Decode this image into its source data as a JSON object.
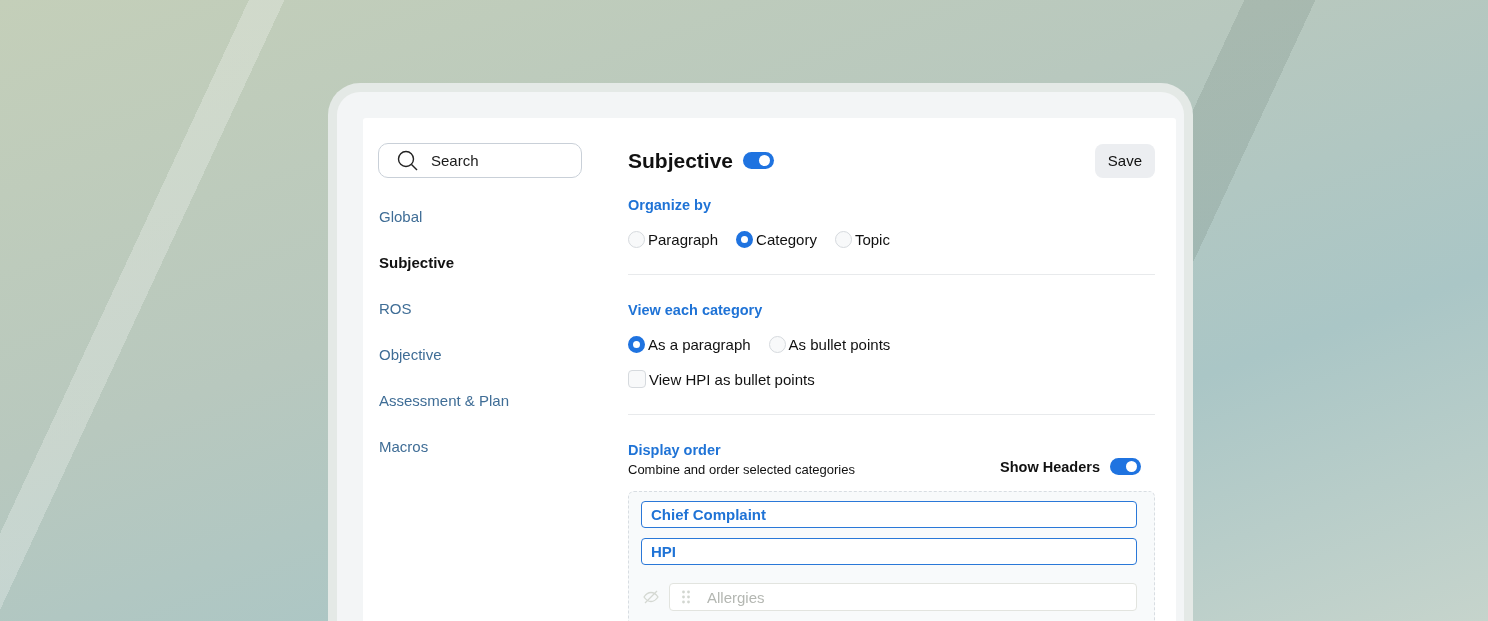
{
  "sidebar": {
    "search": {
      "placeholder": "Search"
    },
    "items": [
      {
        "label": "Global",
        "selected": false
      },
      {
        "label": "Subjective",
        "selected": true
      },
      {
        "label": "ROS",
        "selected": false
      },
      {
        "label": "Objective",
        "selected": false
      },
      {
        "label": "Assessment & Plan",
        "selected": false
      },
      {
        "label": "Macros",
        "selected": false
      }
    ]
  },
  "header": {
    "title": "Subjective",
    "on": true,
    "save": "Save"
  },
  "sections": [
    {
      "heading": "Organize by",
      "options": [
        {
          "label": "Paragraph",
          "selected": false
        },
        {
          "label": "Category",
          "selected": true
        },
        {
          "label": "Topic",
          "selected": false
        }
      ]
    },
    {
      "heading": "View each category",
      "options": [
        {
          "label": "As a paragraph",
          "selected": true
        },
        {
          "label": "As bullet points",
          "selected": false
        }
      ],
      "checks": [
        {
          "label": "View HPI as bullet points",
          "checked": false
        }
      ]
    }
  ],
  "display_order": {
    "heading": "Display order",
    "subtitle": "Combine and order selected categories",
    "show_headers": {
      "label": "Show Headers",
      "on": true
    },
    "categories": [
      {
        "label": "Chief Complaint",
        "included": true
      },
      {
        "label": "HPI",
        "included": true
      },
      {
        "label": "Allergies",
        "included": false
      }
    ]
  }
}
